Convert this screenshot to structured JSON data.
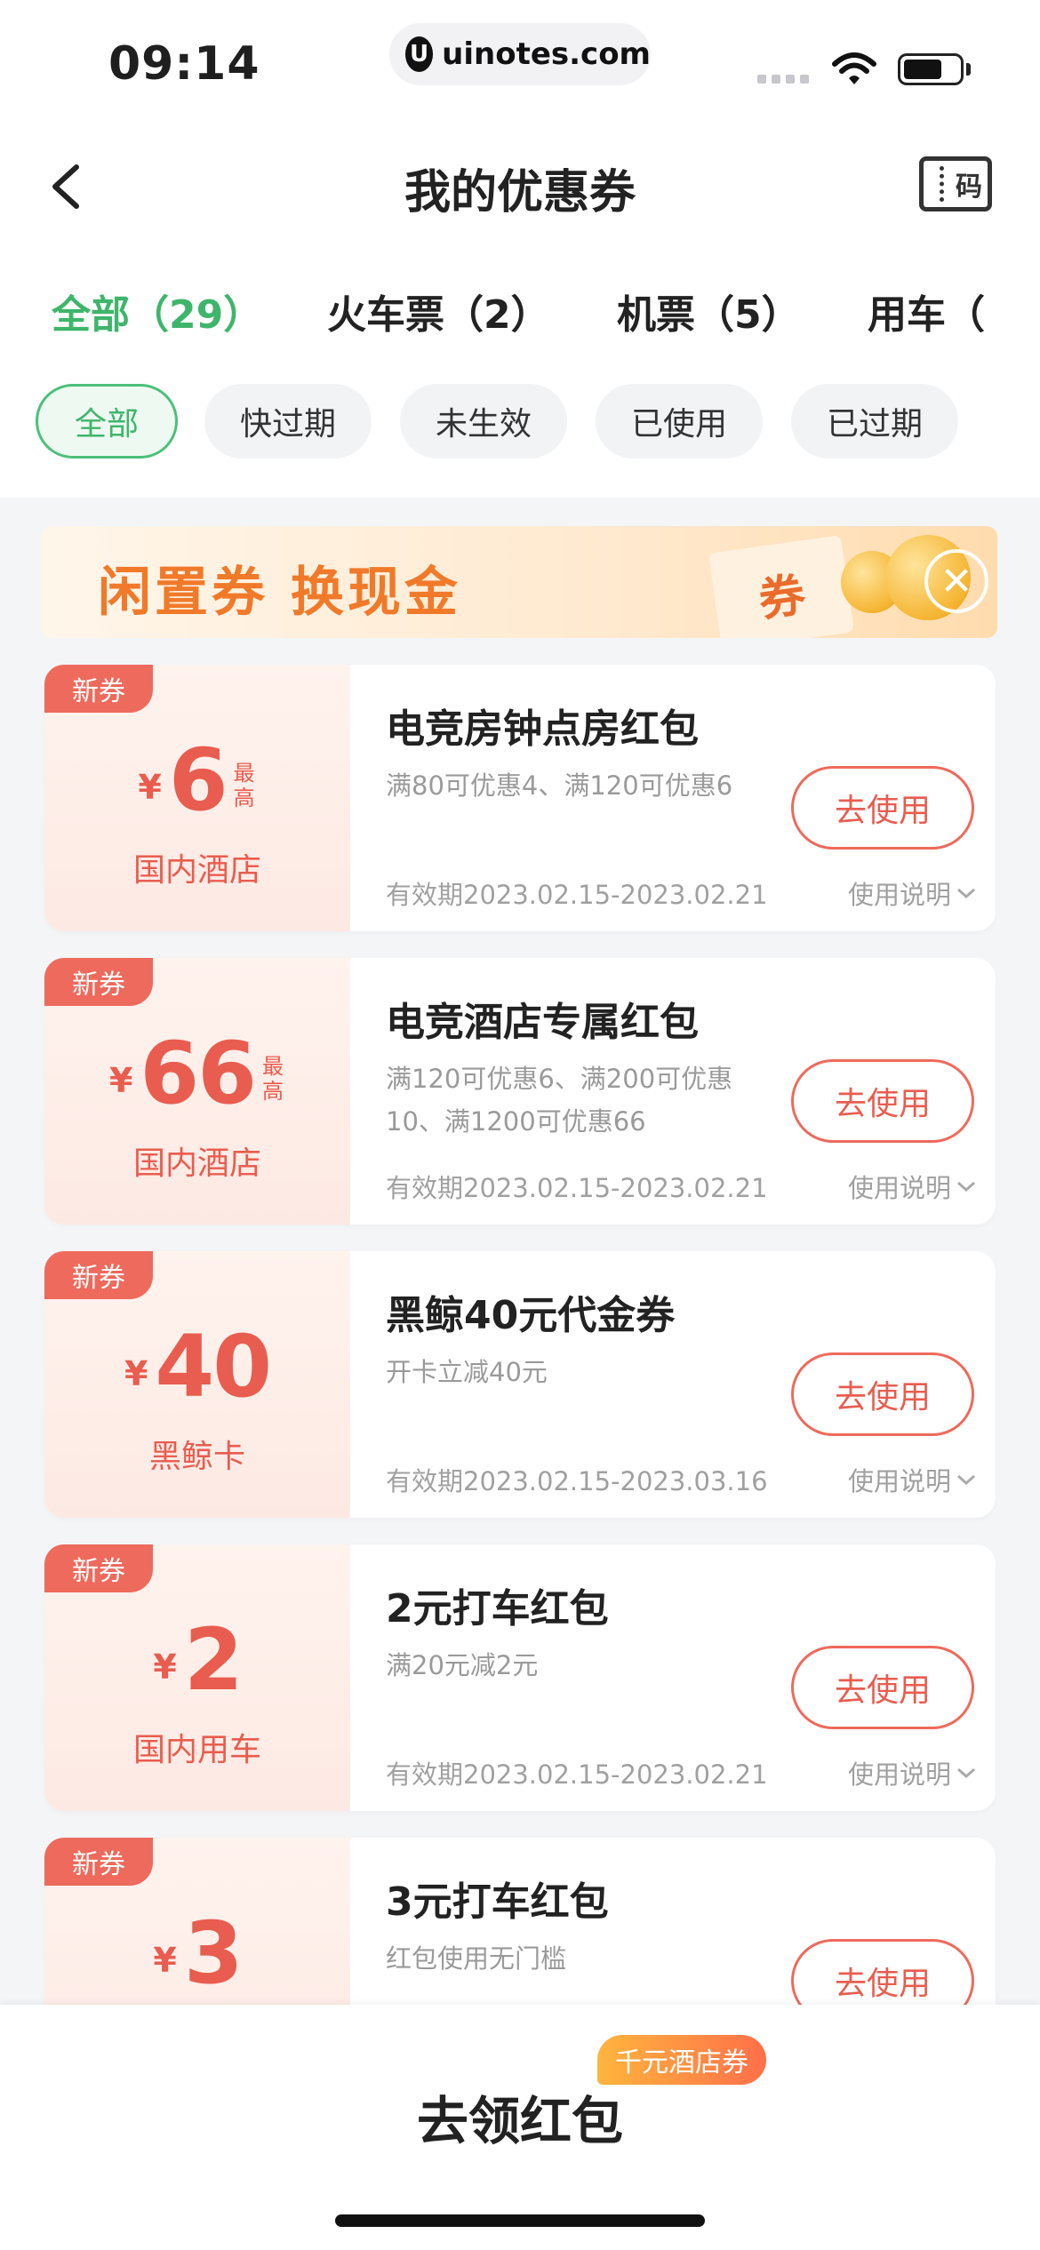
{
  "status_bar": {
    "time": "09:14",
    "url": "uinotes.com",
    "url_logo": "U"
  },
  "header": {
    "title": "我的优惠券",
    "code_label": "码"
  },
  "category_tabs": [
    {
      "label": "全部（29）",
      "active": true
    },
    {
      "label": "火车票（2）",
      "active": false
    },
    {
      "label": "机票（5）",
      "active": false
    },
    {
      "label": "用车（",
      "active": false
    }
  ],
  "filters": [
    {
      "label": "全部",
      "active": true
    },
    {
      "label": "快过期",
      "active": false
    },
    {
      "label": "未生效",
      "active": false
    },
    {
      "label": "已使用",
      "active": false
    },
    {
      "label": "已过期",
      "active": false
    }
  ],
  "banner": {
    "text": "闲置券 换现金",
    "ticket_label": "券",
    "close_glyph": "✕"
  },
  "coupons": [
    {
      "tag": "新券",
      "currency": "¥",
      "amount": "6",
      "max_label": "最高",
      "category": "国内酒店",
      "title": "电竞房钟点房红包",
      "desc": "满80可优惠4、满120可优惠6",
      "button": "去使用",
      "validity": "有效期2023.02.15-2023.02.21",
      "instructions": "使用说明"
    },
    {
      "tag": "新券",
      "currency": "¥",
      "amount": "66",
      "max_label": "最高",
      "category": "国内酒店",
      "title": "电竞酒店专属红包",
      "desc": "满120可优惠6、满200可优惠10、满1200可优惠66",
      "button": "去使用",
      "validity": "有效期2023.02.15-2023.02.21",
      "instructions": "使用说明"
    },
    {
      "tag": "新券",
      "currency": "¥",
      "amount": "40",
      "max_label": "",
      "category": "黑鲸卡",
      "title": "黑鲸40元代金券",
      "desc": "开卡立减40元",
      "button": "去使用",
      "validity": "有效期2023.02.15-2023.03.16",
      "instructions": "使用说明"
    },
    {
      "tag": "新券",
      "currency": "¥",
      "amount": "2",
      "max_label": "",
      "category": "国内用车",
      "title": "2元打车红包",
      "desc": "满20元减2元",
      "button": "去使用",
      "validity": "有效期2023.02.15-2023.02.21",
      "instructions": "使用说明"
    },
    {
      "tag": "新券",
      "currency": "¥",
      "amount": "3",
      "max_label": "",
      "category": "",
      "title": "3元打车红包",
      "desc": "红包使用无门槛",
      "button": "去使用",
      "validity": "",
      "instructions": ""
    }
  ],
  "bottom": {
    "claim_label": "去领红包",
    "promo_badge": "千元酒店券"
  },
  "colors": {
    "accent_green": "#3fb56b",
    "coupon_red": "#e85d4f",
    "tag_red": "#ee6a5c",
    "banner_orange": "#f07a2a"
  }
}
